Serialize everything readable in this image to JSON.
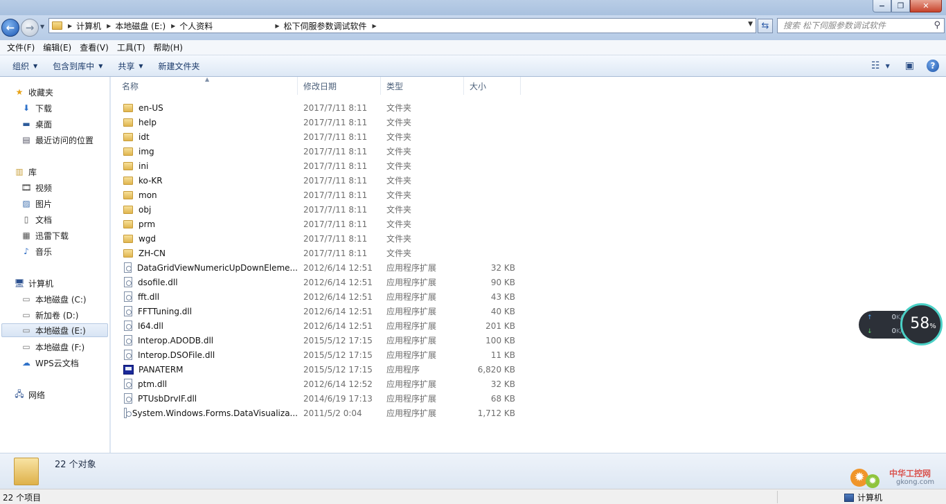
{
  "window": {
    "caption_buttons": [
      "−",
      "❐",
      "✕"
    ]
  },
  "address": {
    "crumbs": [
      "计算机",
      "本地磁盘 (E:)",
      "个人资料",
      "松下伺服参数调试软件"
    ],
    "search_placeholder": "搜索 松下伺服参数调试软件"
  },
  "menu": [
    "文件(F)",
    "编辑(E)",
    "查看(V)",
    "工具(T)",
    "帮助(H)"
  ],
  "toolbar": {
    "organize": "组织",
    "include_library": "包含到库中",
    "share": "共享",
    "new_folder": "新建文件夹"
  },
  "nav": {
    "favorites": "收藏夹",
    "downloads": "下载",
    "desktop": "桌面",
    "recent": "最近访问的位置",
    "libraries": "库",
    "videos": "视频",
    "pictures": "图片",
    "documents": "文档",
    "thunder": "迅雷下载",
    "music": "音乐",
    "computer": "计算机",
    "drive_c": "本地磁盘 (C:)",
    "drive_d": "新加卷 (D:)",
    "drive_e": "本地磁盘 (E:)",
    "drive_f": "本地磁盘 (F:)",
    "wps": "WPS云文档",
    "network": "网络"
  },
  "columns": {
    "name": "名称",
    "modified": "修改日期",
    "type": "类型",
    "size": "大小"
  },
  "files": [
    {
      "name": "en-US",
      "date": "2017/7/11 8:11",
      "type": "文件夹",
      "size": "",
      "kind": "folder"
    },
    {
      "name": "help",
      "date": "2017/7/11 8:11",
      "type": "文件夹",
      "size": "",
      "kind": "folder"
    },
    {
      "name": "idt",
      "date": "2017/7/11 8:11",
      "type": "文件夹",
      "size": "",
      "kind": "folder"
    },
    {
      "name": "img",
      "date": "2017/7/11 8:11",
      "type": "文件夹",
      "size": "",
      "kind": "folder"
    },
    {
      "name": "ini",
      "date": "2017/7/11 8:11",
      "type": "文件夹",
      "size": "",
      "kind": "folder"
    },
    {
      "name": "ko-KR",
      "date": "2017/7/11 8:11",
      "type": "文件夹",
      "size": "",
      "kind": "folder"
    },
    {
      "name": "mon",
      "date": "2017/7/11 8:11",
      "type": "文件夹",
      "size": "",
      "kind": "folder"
    },
    {
      "name": "obj",
      "date": "2017/7/11 8:11",
      "type": "文件夹",
      "size": "",
      "kind": "folder"
    },
    {
      "name": "prm",
      "date": "2017/7/11 8:11",
      "type": "文件夹",
      "size": "",
      "kind": "folder"
    },
    {
      "name": "wgd",
      "date": "2017/7/11 8:11",
      "type": "文件夹",
      "size": "",
      "kind": "folder"
    },
    {
      "name": "ZH-CN",
      "date": "2017/7/11 8:11",
      "type": "文件夹",
      "size": "",
      "kind": "folder"
    },
    {
      "name": "DataGridViewNumericUpDownEleme...",
      "date": "2012/6/14 12:51",
      "type": "应用程序扩展",
      "size": "32 KB",
      "kind": "dll"
    },
    {
      "name": "dsofile.dll",
      "date": "2012/6/14 12:51",
      "type": "应用程序扩展",
      "size": "90 KB",
      "kind": "dll"
    },
    {
      "name": "fft.dll",
      "date": "2012/6/14 12:51",
      "type": "应用程序扩展",
      "size": "43 KB",
      "kind": "dll"
    },
    {
      "name": "FFTTuning.dll",
      "date": "2012/6/14 12:51",
      "type": "应用程序扩展",
      "size": "40 KB",
      "kind": "dll"
    },
    {
      "name": "I64.dll",
      "date": "2012/6/14 12:51",
      "type": "应用程序扩展",
      "size": "201 KB",
      "kind": "dll"
    },
    {
      "name": "Interop.ADODB.dll",
      "date": "2015/5/12 17:15",
      "type": "应用程序扩展",
      "size": "100 KB",
      "kind": "dll"
    },
    {
      "name": "Interop.DSOFile.dll",
      "date": "2015/5/12 17:15",
      "type": "应用程序扩展",
      "size": "11 KB",
      "kind": "dll"
    },
    {
      "name": "PANATERM",
      "date": "2015/5/12 17:15",
      "type": "应用程序",
      "size": "6,820 KB",
      "kind": "exe"
    },
    {
      "name": "ptm.dll",
      "date": "2012/6/14 12:52",
      "type": "应用程序扩展",
      "size": "32 KB",
      "kind": "dll"
    },
    {
      "name": "PTUsbDrvIF.dll",
      "date": "2014/6/19 17:13",
      "type": "应用程序扩展",
      "size": "68 KB",
      "kind": "dll"
    },
    {
      "name": "System.Windows.Forms.DataVisualiza...",
      "date": "2011/5/2 0:04",
      "type": "应用程序扩展",
      "size": "1,712 KB",
      "kind": "dll"
    }
  ],
  "details": {
    "count": "22 个对象"
  },
  "status": {
    "count": "22 个项目",
    "location": "计算机"
  },
  "network_widget": {
    "up": "0",
    "down": "0",
    "unit": "K/s",
    "percent": "58",
    "percent_unit": "%"
  },
  "watermark": {
    "text": "中华工控网",
    "url": "gkong.com"
  },
  "colors": {
    "accent": "#1b56b2",
    "meter_ring": "#4ad0c6"
  }
}
